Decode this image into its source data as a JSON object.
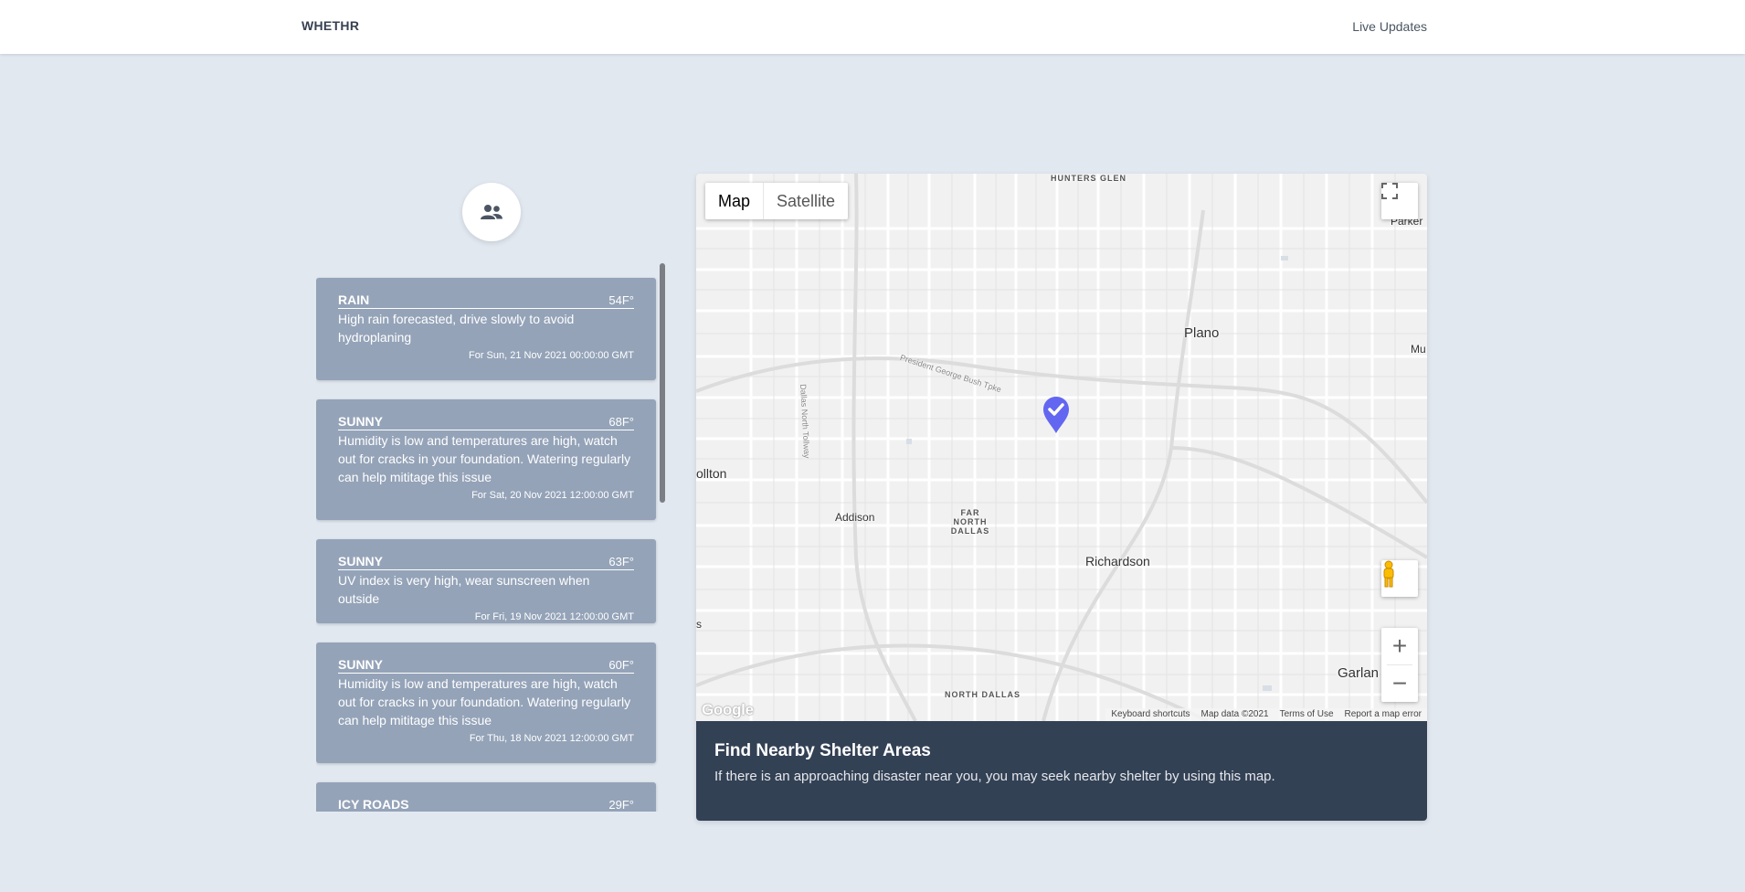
{
  "header": {
    "brand": "WHETHR",
    "live_updates": "Live Updates"
  },
  "feed": {
    "avatar_icon": "users-icon",
    "items": [
      {
        "type": "RAIN",
        "temp": "54F°",
        "message": "High rain forecasted, drive slowly to avoid hydroplaning",
        "date": "For Sun, 21 Nov 2021 00:00:00 GMT"
      },
      {
        "type": "SUNNY",
        "temp": "68F°",
        "message": "Humidity is low and temperatures are high, watch out for cracks in your foundation. Watering regularly can help mititage this issue",
        "date": "For Sat, 20 Nov 2021 12:00:00 GMT"
      },
      {
        "type": "SUNNY",
        "temp": "63F°",
        "message": "UV index is very high, wear sunscreen when outside",
        "date": "For Fri, 19 Nov 2021 12:00:00 GMT"
      },
      {
        "type": "SUNNY",
        "temp": "60F°",
        "message": "Humidity is low and temperatures are high, watch out for cracks in your foundation. Watering regularly can help mititage this issue",
        "date": "For Thu, 18 Nov 2021 12:00:00 GMT"
      },
      {
        "type": "ICY ROADS",
        "temp": "29F°",
        "message": "",
        "date": ""
      }
    ]
  },
  "map": {
    "type_map": "Map",
    "type_satellite": "Satellite",
    "labels": {
      "hunters_glen": "HUNTERS GLEN",
      "parker": "Parker",
      "plano": "Plano",
      "mu": "Mu",
      "carrollton": "ollton",
      "addison": "Addison",
      "far_north_dallas": "FAR NORTH DALLAS",
      "richardson": "Richardson",
      "garland": "Garlan",
      "north_dallas": "NORTH DALLAS",
      "bush_tpke": "President George Bush Tpke",
      "dnt": "Dallas North Tollway",
      "s_edge": "s"
    },
    "attribution": {
      "shortcuts": "Keyboard shortcuts",
      "data": "Map data ©2021",
      "terms": "Terms of Use",
      "report": "Report a map error"
    },
    "google": "Google",
    "zoom_in": "+",
    "zoom_out": "−",
    "footer_title": "Find Nearby Shelter Areas",
    "footer_text": "If there is an approaching disaster near you, you may seek nearby shelter by using this map.",
    "marker_color": "#6366f1"
  }
}
